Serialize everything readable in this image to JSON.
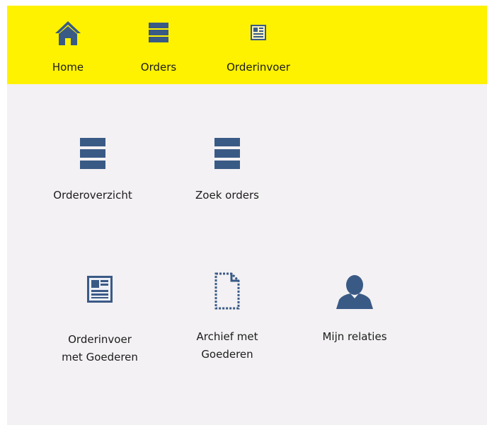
{
  "nav": {
    "items": [
      {
        "label": "Home",
        "icon": "home-icon"
      },
      {
        "label": "Orders",
        "icon": "list-icon"
      },
      {
        "label": "Orderinvoer",
        "icon": "newspaper-icon"
      }
    ]
  },
  "tiles": [
    {
      "label": "Orderoverzicht",
      "icon": "list-icon"
    },
    {
      "label": "Zoek orders",
      "icon": "list-icon"
    },
    {
      "label_line1": "Orderinvoer",
      "label_line2": "met Goederen",
      "icon": "newspaper-icon"
    },
    {
      "label_line1": "Archief met",
      "label_line2": "Goederen",
      "icon": "document-outline-icon"
    },
    {
      "label": "Mijn relaties",
      "icon": "person-icon"
    }
  ],
  "colors": {
    "header_bg": "#fff200",
    "content_bg": "#f3f1f3",
    "icon": "#3a5a86"
  }
}
